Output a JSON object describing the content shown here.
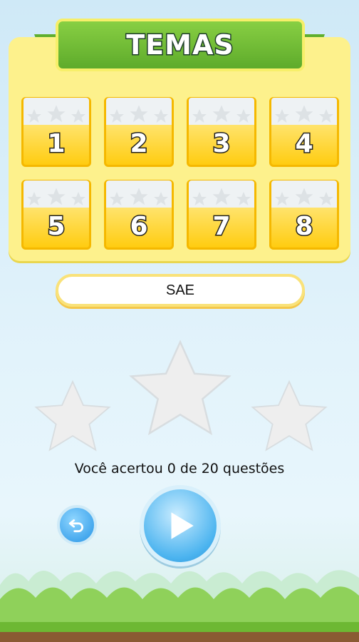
{
  "header": {
    "title": "TEMAS"
  },
  "themes": [
    {
      "label": "1",
      "stars": 0
    },
    {
      "label": "2",
      "stars": 0
    },
    {
      "label": "3",
      "stars": 0
    },
    {
      "label": "4",
      "stars": 0
    },
    {
      "label": "5",
      "stars": 0
    },
    {
      "label": "6",
      "stars": 0
    },
    {
      "label": "7",
      "stars": 0
    },
    {
      "label": "8",
      "stars": 0
    }
  ],
  "subject": {
    "label": "SAE"
  },
  "result": {
    "stars_earned": 0,
    "stars_total": 3,
    "text": "Você acertou 0 de 20 questões"
  },
  "controls": {
    "back_icon": "undo-arrow-icon",
    "play_icon": "play-icon"
  },
  "colors": {
    "tile": "#ffcc10",
    "banner": "#6db833",
    "button": "#2795e6"
  }
}
